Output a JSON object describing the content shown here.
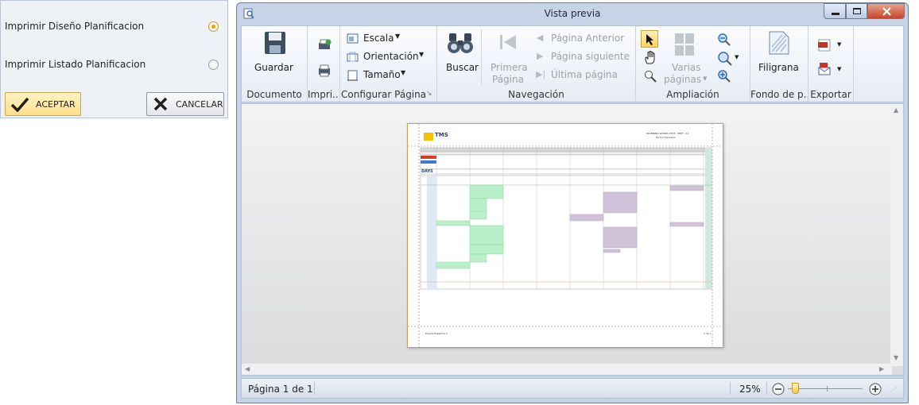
{
  "dialog": {
    "option1": "Imprimir Diseño Planificacion",
    "option2": "Imprimir Listado Planificacion",
    "accept": "ACEPTAR",
    "cancel": "CANCELAR"
  },
  "window": {
    "title": "Vista previa"
  },
  "ribbon": {
    "documento": {
      "label": "Documento",
      "guardar": "Guardar"
    },
    "imprimir": {
      "label": "Impri..."
    },
    "configurar": {
      "label": "Configurar Página",
      "escala": "Escala",
      "orientacion": "Orientación",
      "tamano": "Tamaño"
    },
    "navegacion": {
      "label": "Navegación",
      "buscar": "Buscar",
      "primera1": "Primera",
      "primera2": "Página",
      "anterior": "Página Anterior",
      "siguiente": "Página siguiente",
      "ultima": "Última página"
    },
    "ampliacion": {
      "label": "Ampliación",
      "varias1": "Varias",
      "varias2": "páginas"
    },
    "fondo": {
      "label": "Fondo de p...",
      "filigrana": "Filigrana"
    },
    "exportar": {
      "label": "Exportar"
    }
  },
  "page": {
    "logo": "TMS",
    "header_right1": "PLANNING WORKS 2015 - SEPT - 11",
    "header_right2": "Fecha Impresión",
    "days_label": "DAYS",
    "footer_left": "Fuente Española 4",
    "footer_right": "1 de 1"
  },
  "status": {
    "page": "Página 1 de 1",
    "zoom": "25%"
  },
  "colors": {
    "accent": "#e8a400",
    "ribbon": "#e6ecf5",
    "frame": "#c7d4e7",
    "green_block": "#b9f0c9",
    "purple_block": "#cfc2d9"
  }
}
